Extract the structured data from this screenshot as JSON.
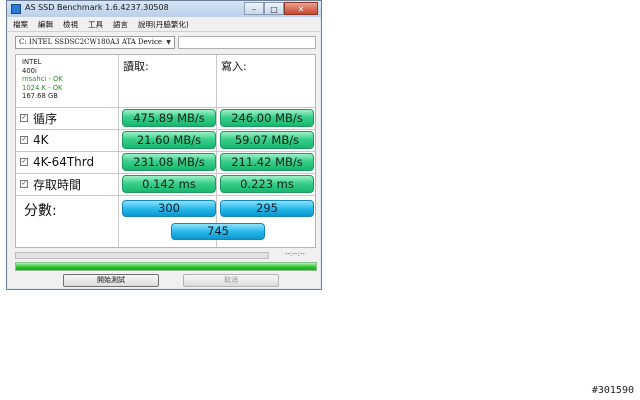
{
  "window": {
    "title": "AS SSD Benchmark 1.6.4237.30508",
    "controls": {
      "minimize": "–",
      "maximize": "□",
      "close": "✕"
    }
  },
  "menu": [
    "檔案",
    "編輯",
    "檢視",
    "工具",
    "語言",
    "說明(丹脇繁化)"
  ],
  "drive": {
    "selected": "C: INTEL SSDSC2CW180A3 ATA Device",
    "arrow": "▼"
  },
  "info": {
    "vendor": "INTEL",
    "firmware": "400i",
    "driver_status": "msahci - OK",
    "alignment_status": "1024 K - OK",
    "size": "167.68 GB"
  },
  "columns": {
    "read": "讀取:",
    "write": "寫入:"
  },
  "rows": [
    {
      "label": "循序",
      "read": "475.89 MB/s",
      "write": "246.00 MB/s",
      "checked": true
    },
    {
      "label": "4K",
      "read": "21.60 MB/s",
      "write": "59.07 MB/s",
      "checked": true
    },
    {
      "label": "4K-64Thrd",
      "read": "231.08 MB/s",
      "write": "211.42 MB/s",
      "checked": true
    },
    {
      "label": "存取時間",
      "read": "0.142 ms",
      "write": "0.223 ms",
      "checked": true
    }
  ],
  "check_glyph": "✓",
  "score": {
    "label": "分數:",
    "read": "300",
    "write": "295",
    "total": "745"
  },
  "progress": {
    "time": "--:--:--",
    "bar1_fraction": 0,
    "bar2_fraction": 1.0
  },
  "buttons": {
    "start": "開始測試",
    "cancel": "取消"
  },
  "watermark": "#301590",
  "colors": {
    "green_cell": "#2fd088",
    "blue_cell": "#29b9ea",
    "progress_green": "#2fc52f"
  }
}
